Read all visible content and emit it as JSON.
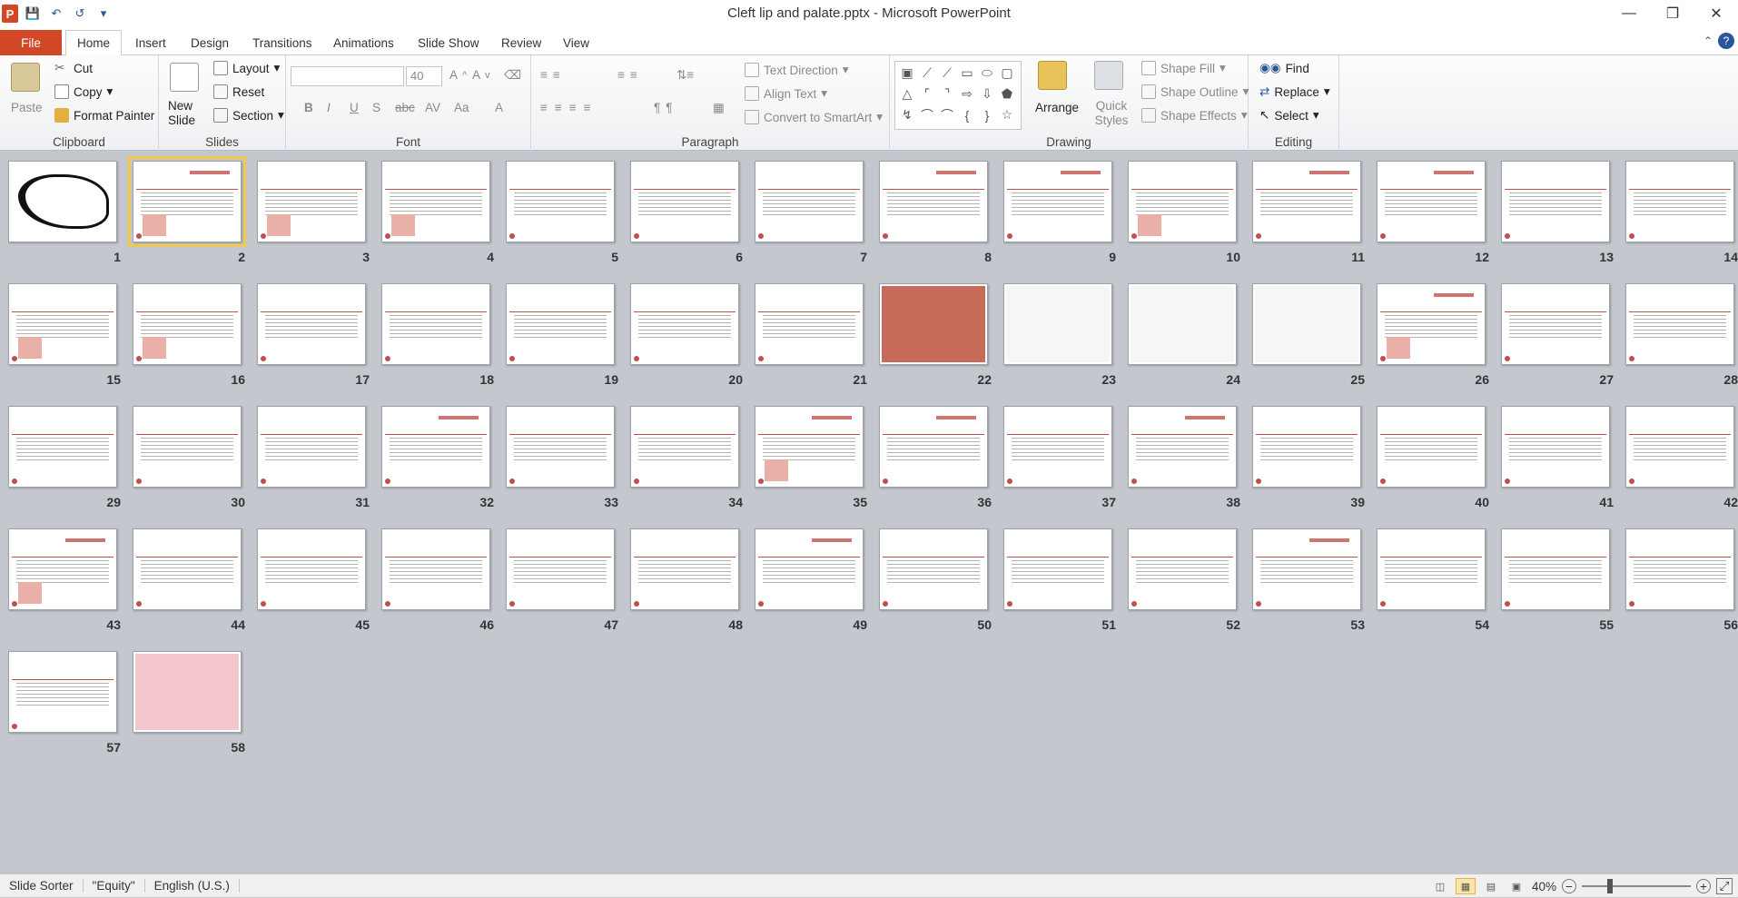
{
  "window": {
    "title": "Cleft lip and palate.pptx - Microsoft PowerPoint"
  },
  "qat": {
    "app_icon": "P"
  },
  "tabs": [
    "File",
    "Home",
    "Insert",
    "Design",
    "Transitions",
    "Animations",
    "Slide Show",
    "Review",
    "View"
  ],
  "ribbon": {
    "clipboard": {
      "paste": "Paste",
      "cut": "Cut",
      "copy": "Copy",
      "format_painter": "Format Painter",
      "label": "Clipboard"
    },
    "slides": {
      "new_slide": "New Slide",
      "layout": "Layout",
      "reset": "Reset",
      "section": "Section",
      "label": "Slides"
    },
    "font": {
      "name": "",
      "size": "40",
      "label": "Font"
    },
    "paragraph": {
      "text_direction": "Text Direction",
      "align_text": "Align Text",
      "convert": "Convert to SmartArt",
      "label": "Paragraph"
    },
    "drawing": {
      "arrange": "Arrange",
      "quick_styles": "Quick Styles",
      "shape_fill": "Shape Fill",
      "shape_outline": "Shape Outline",
      "shape_effects": "Shape Effects",
      "label": "Drawing"
    },
    "editing": {
      "find": "Find",
      "replace": "Replace",
      "select": "Select",
      "label": "Editing"
    }
  },
  "slides": [
    "1",
    "2",
    "3",
    "4",
    "5",
    "6",
    "7",
    "8",
    "9",
    "10",
    "11",
    "12",
    "13",
    "14",
    "15",
    "16",
    "17",
    "18",
    "19",
    "20",
    "21",
    "22",
    "23",
    "24",
    "25",
    "26",
    "27",
    "28",
    "29",
    "30",
    "31",
    "32",
    "33",
    "34",
    "35",
    "36",
    "37",
    "38",
    "39",
    "40",
    "41",
    "42",
    "43",
    "44",
    "45",
    "46",
    "47",
    "48",
    "49",
    "50",
    "51",
    "52",
    "53",
    "54",
    "55",
    "56",
    "57",
    "58"
  ],
  "selected_slide": 2,
  "status": {
    "view": "Slide Sorter",
    "theme": "\"Equity\"",
    "language": "English (U.S.)",
    "zoom": "40%"
  }
}
